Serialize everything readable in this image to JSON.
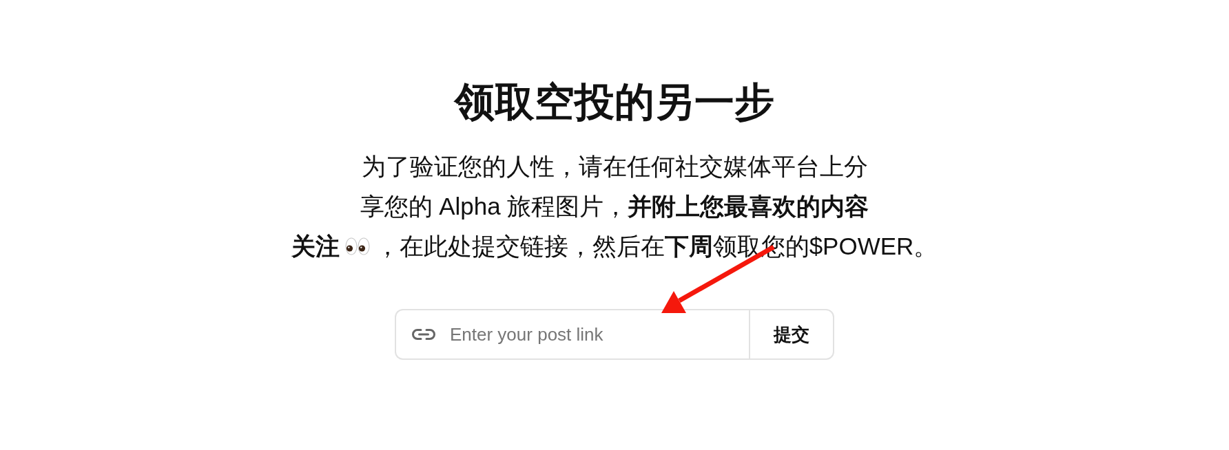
{
  "title": "领取空投的另一步",
  "description": {
    "lines": [
      "为了验证您的人性，请在任何社交媒体平台上分",
      "享您的 Alpha 旅程图片，**并附上您最喜欢的内容**"
    ],
    "follow_label": "关注",
    "closing": "，在此处提交链接，然后在**下周**领取您的$POWER。"
  },
  "link_form": {
    "placeholder": "Enter your post link",
    "submit_label": "提交"
  }
}
